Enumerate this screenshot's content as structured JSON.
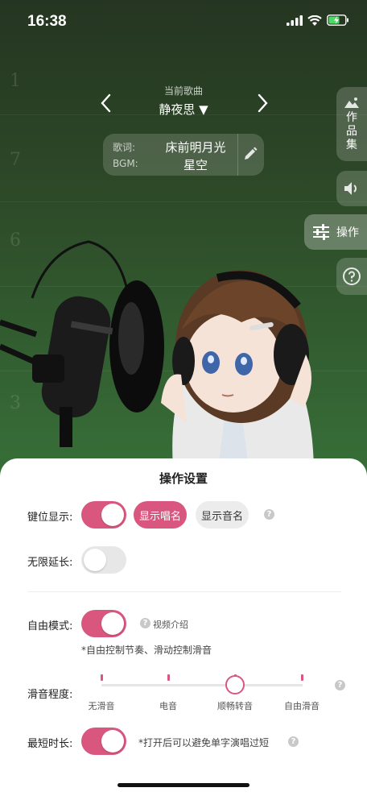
{
  "status_bar": {
    "time": "16:38"
  },
  "song_selector": {
    "caption": "当前歌曲",
    "song_name": "静夜思 ▼"
  },
  "lyrics_card": {
    "lyrics_label": "歌词:",
    "lyrics_value": "床前明月光",
    "bgm_label": "BGM:",
    "bgm_value": "星空"
  },
  "side_menu": {
    "works_label": "作品集",
    "operate_label": "操作"
  },
  "staff_numbers": [
    "1",
    "7",
    "6",
    "3"
  ],
  "settings": {
    "title": "操作设置",
    "key_display": {
      "label": "键位显示:",
      "enabled": true,
      "options": [
        "显示唱名",
        "显示音名"
      ],
      "selected": "显示唱名"
    },
    "infinite_extend": {
      "label": "无限延长:",
      "enabled": false
    },
    "free_mode": {
      "label": "自由模式:",
      "enabled": true,
      "video_link": "视频介绍",
      "hint": "*自由控制节奏、滑动控制滑音"
    },
    "glide_level": {
      "label": "滑音程度:",
      "options": [
        "无滑音",
        "电音",
        "顺畅转音",
        "自由滑音"
      ],
      "selected_index": 2
    },
    "min_duration": {
      "label": "最短时长:",
      "enabled": true,
      "hint": "*打开后可以避免单字演唱过短"
    }
  },
  "colors": {
    "accent": "#d9577f",
    "toggle_off": "#e7e7e7",
    "background_green": "#366a36"
  }
}
